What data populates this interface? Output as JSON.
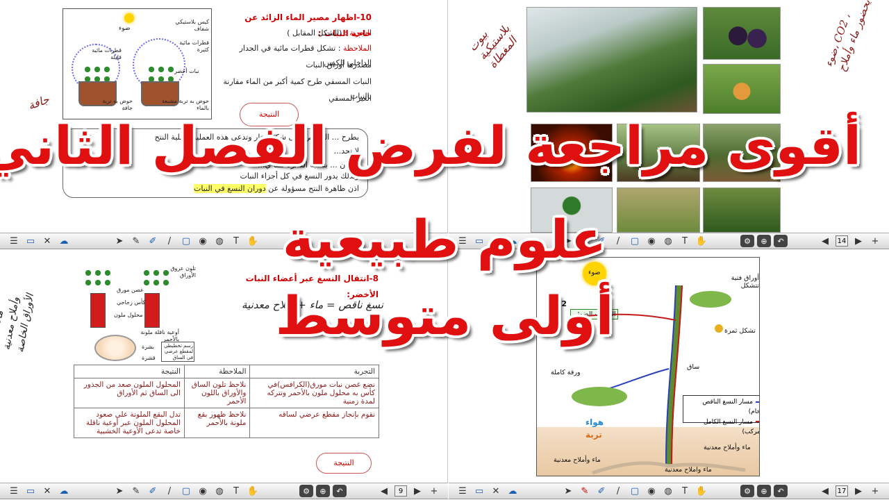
{
  "headline": {
    "line1": "أقوى مراجعة لفرض الفصل الثاني",
    "line2": "علوم طبيعية",
    "line3": "أولى متوسط"
  },
  "top_left": {
    "title": "10-اظهار مصير الماء الزائد عن حاجة النبات :",
    "experiment_label": "التجربة",
    "experiment_value": ": (الشكل المقابل )",
    "observation_label": "الملاحظة",
    "observation_text": ": تشكل قطرات مائية في الجدار الداخلي للكيس",
    "line3": "مصدرها أوراق النبات",
    "line4": "النبات المسقي طرح كمية أكبر من الماء مقارنة بالنبات",
    "line5": "الغير المسقي",
    "result_cloud": "النتيجة",
    "bullets": [
      "يطرح ... الممتص على شكل بخار وتدعى هذه العملية بعملية النتح",
      "لا تحد...",
      "فقدان ... بشبيه الدائرة مما ي...",
      "وبذلك يدور النسغ في كل أجزاء النبات"
    ],
    "last_line_pre": "اذن ظاهرة النتح مسؤولة عن ",
    "last_line_highlight": "دوران النسغ في النبات",
    "diagram_labels": {
      "light": "ضوء",
      "plastic_bag": "كيس بلاستيكي شفاف",
      "drops_many": "قطرات مائية كثيرة",
      "drops_few": "قطرات مائية قليلة",
      "green_plant": "نبات أخضر",
      "pot_dry": "حوض به تربة جافة",
      "pot_wet": "حوض به تربة مشبعة بالماء"
    },
    "handwriting": "جافة"
  },
  "top_right": {
    "handwriting_left": "بيوت بلاستيكية المغطاة",
    "handwriting_right": "ضوء، CO2 ، يحضور ماء وأملاح"
  },
  "bottom_left": {
    "title": "8-انتقال النسغ عبر أعضاء النبات الأخضر:",
    "handwriting_center": "نسغ ناقص = ماء + أملاح معدنية",
    "handwriting_left": "ضوء ، يحضور CO2 ماء وأملاح معدنية الأوراق الخاصة",
    "diagram_labels": {
      "colored_veins": "تلون عروق الأوراق",
      "branch": "غصن مورق",
      "glass": "كأس زجاجي",
      "colored_solution": "محلول ملون",
      "xylem": "أوعية ناقلة ملونة بالأحمر",
      "cross_section": "رسم تخطيطي لمقطع عرضي في الساق",
      "bark": "بشرة",
      "cortex": "قشرة"
    },
    "table": {
      "headers": [
        "التجربة",
        "الملاحظة",
        "النتيجة"
      ],
      "rows": [
        [
          "نضع غصن نبات مورق(الكرافس)في كأس به محلول ملون بالأحمر ونتركه لمدة زمنية",
          "نلاحظ تلون الساق والأوراق باللون الأحمر",
          "المحلول الملون صعد من الجذور الى الساق ثم الأوراق"
        ],
        [
          "نقوم بإنجاز مقطع عرضي لساقه",
          "نلاحظ ظهور بقع ملونة بالأحمر",
          "تدل البقع الملونة على صعود المحلول الملون عبر أوعية ناقلة خاصة تدعى الأوعية الخشبية"
        ]
      ]
    },
    "result_cloud": "النتيجة"
  },
  "bottom_right": {
    "labels": {
      "light": "ضوء",
      "co2": "CO2",
      "o2": "O2",
      "photosynthesis": "التركيب الضوئي",
      "young_leaves": "أوراق فتية تتشكل",
      "fruit": "تشكل ثمرة",
      "stem": "ساق",
      "mature_leaf": "ورقة كاملة",
      "air": "هواء",
      "soil": "تربة",
      "water_salts_1": "ماء وأملاح معدنية",
      "water_salts_2": "ماء وأملاح معدنية",
      "water_salts_3": "ماء وأملاح معدنية"
    },
    "legend": {
      "raw_sap": "مسار النسغ الناقص (الخام)",
      "elaborated_sap": "مسار النسغ الكامل (المركب)"
    },
    "colors": {
      "raw_sap": "#2a3fbf",
      "elaborated_sap": "#c21a1a"
    }
  },
  "toolbars": {
    "page_tl": "",
    "page_tr": "14",
    "page_bl": "9",
    "page_br": "17"
  }
}
